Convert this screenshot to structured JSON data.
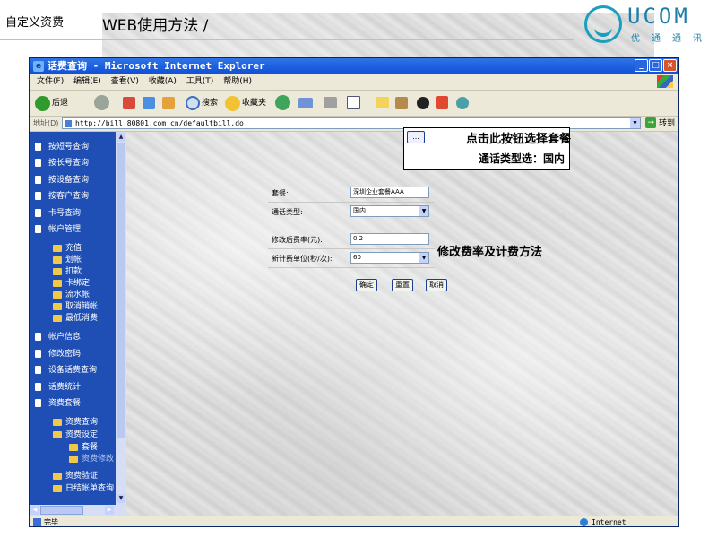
{
  "slide": {
    "title_main": "WEB使用方法 / ",
    "title_sub": "自定义资费",
    "logo_text": "UCOM",
    "logo_subtext": "优通通讯"
  },
  "window": {
    "title": "话费查询 - Microsoft Internet Explorer",
    "buttons": [
      "_",
      "□",
      "×"
    ]
  },
  "menu": [
    "文件(F)",
    "编辑(E)",
    "查看(V)",
    "收藏(A)",
    "工具(T)",
    "帮助(H)"
  ],
  "toolbar": {
    "back": "后退",
    "search": "搜索",
    "favorites": "收藏夹"
  },
  "address": {
    "label": "地址(D)",
    "url": "http://bill.80801.com.cn/defaultbill.do",
    "go": "转到"
  },
  "sidebar": {
    "items": [
      "按短号查询",
      "按长号查询",
      "按设备查询",
      "按客户查询",
      "卡号查询",
      "帐户管理"
    ],
    "account_sub": [
      "充值",
      "划帐",
      "扣款",
      "卡绑定",
      "流水帐",
      "取消销帐",
      "最低消费"
    ],
    "items2": [
      "帐户信息",
      "修改密码",
      "设备话费查询",
      "话费统计",
      "资费套餐"
    ],
    "tariff_sub": [
      "资费查询",
      "资费设定"
    ],
    "tariff_sub2": [
      "套餐",
      "资费修改"
    ],
    "tariff_sub3": [
      "资费验证",
      "日结帐单查询"
    ]
  },
  "form": {
    "package_label": "套餐:",
    "package_value": "深圳企业套餐AAA",
    "calltype_label": "通话类型:",
    "calltype_value": "国内",
    "rate_label": "修改后费率(元):",
    "rate_value": "0.2",
    "unit_label": "新计费单位(秒/次):",
    "unit_value": "60",
    "confirm": "确定",
    "reset": "重置",
    "cancel": "取消"
  },
  "annotations": {
    "picker_button": "...",
    "note1": "点击此按钮选择套餐",
    "note2": "通话类型选：国内",
    "note3": "修改费率及计费方法"
  },
  "status": {
    "done": "完毕",
    "zone": "Internet"
  }
}
